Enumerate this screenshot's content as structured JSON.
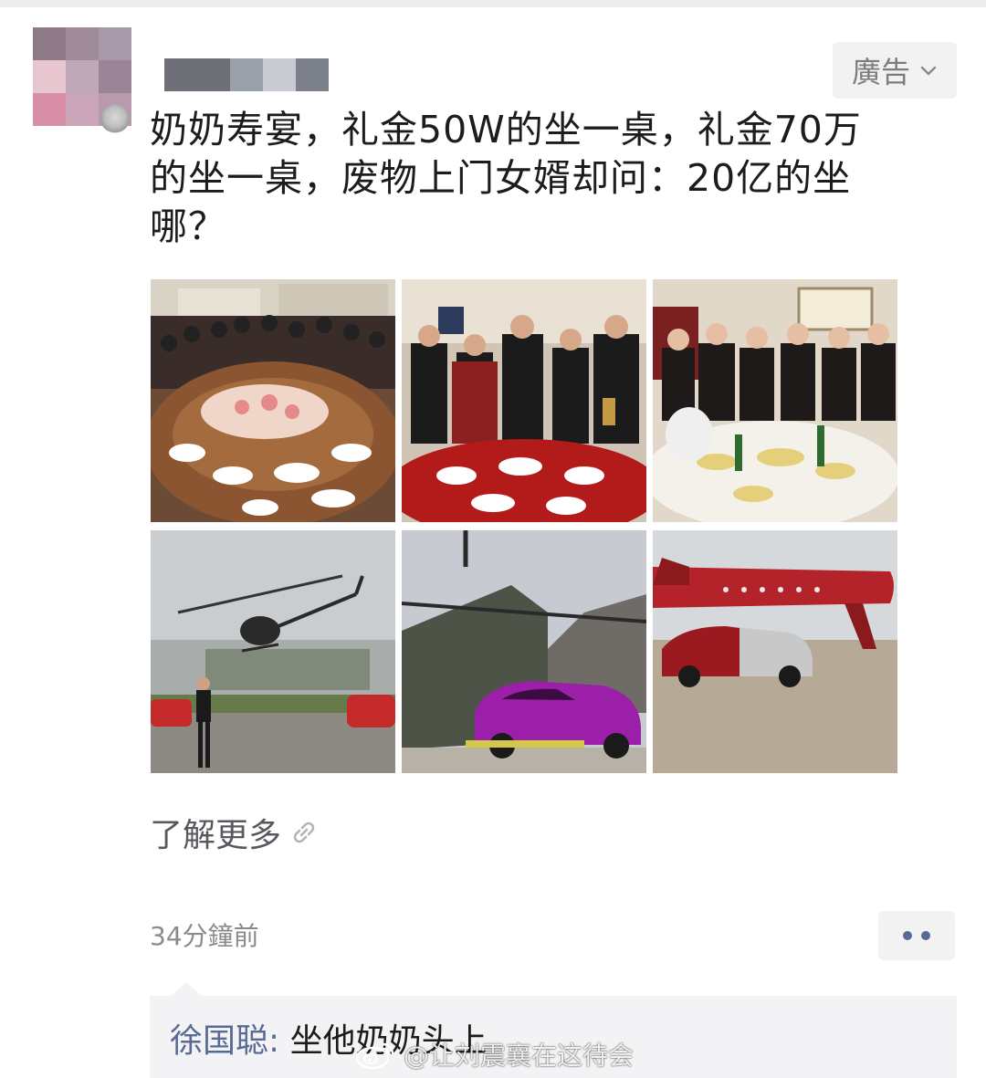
{
  "post": {
    "ad_label": "廣告",
    "text": "奶奶寿宴，礼金50W的坐一桌，礼金70万\n的坐一桌，废物上门女婿却问：20亿的坐\n哪？",
    "learn_more": "了解更多",
    "timestamp": "34分鐘前"
  },
  "images": [
    {
      "icon": "banquet-table-photo"
    },
    {
      "icon": "toast-guests-photo"
    },
    {
      "icon": "women-banquet-photo"
    },
    {
      "icon": "helicopter-photo"
    },
    {
      "icon": "chinook-sports-car-photo"
    },
    {
      "icon": "private-jet-supercar-photo"
    }
  ],
  "comment": {
    "author": "徐国聪",
    "separator": ":",
    "text": " 坐他奶奶头上"
  },
  "watermark": {
    "text": "@让刘震襄在这待会"
  },
  "colors": {
    "link_blue": "#576b95",
    "ad_bg": "#f2f2f2",
    "comment_bg": "#f3f3f5",
    "muted_text": "#8a8a8a"
  }
}
